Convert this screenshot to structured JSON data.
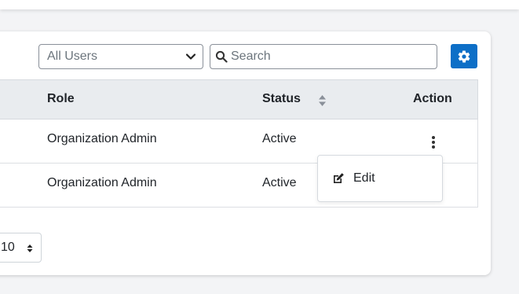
{
  "filter": {
    "selected": "All Users"
  },
  "search": {
    "placeholder": "Search",
    "value": ""
  },
  "table": {
    "headers": {
      "role": "Role",
      "status": "Status",
      "action": "Action"
    },
    "rows": [
      {
        "role": "Organization Admin",
        "status": "Active"
      },
      {
        "role": "Organization Admin",
        "status": "Active"
      }
    ]
  },
  "action_menu": {
    "edit_label": "Edit"
  },
  "pagination": {
    "page_size": "10"
  },
  "colors": {
    "accent": "#0d6fc7",
    "header_bg": "#e9ecef"
  }
}
